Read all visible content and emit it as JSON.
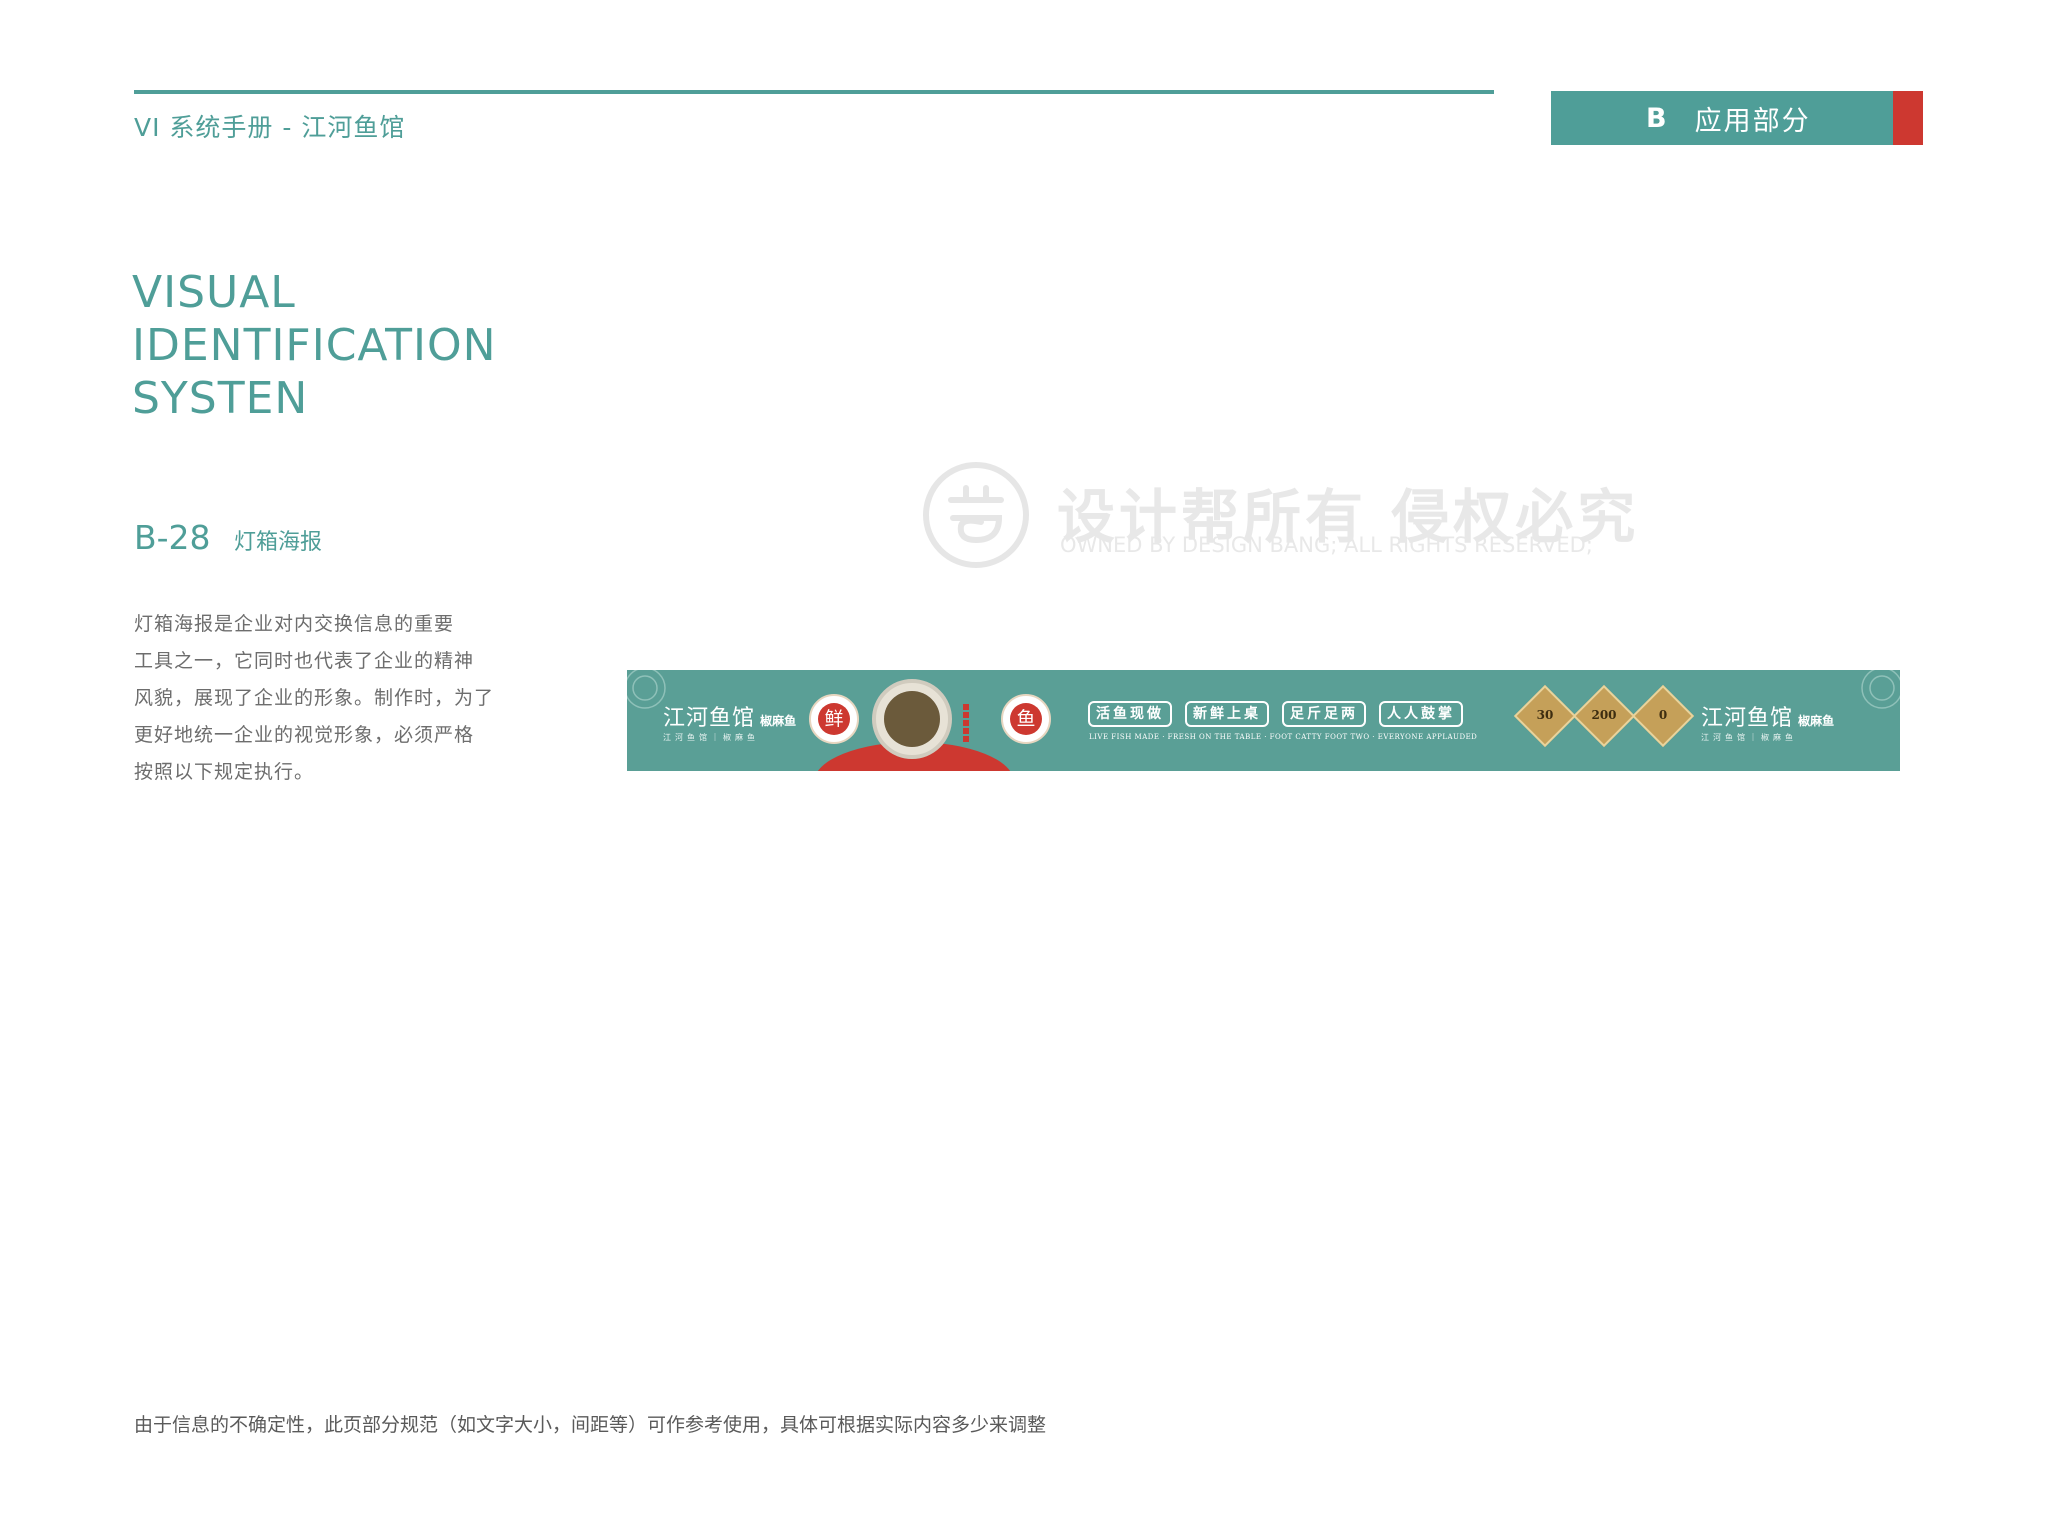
{
  "header": {
    "manual_title": "VI 系统手册 - 江河鱼馆",
    "section_letter": "B",
    "section_name": "应用部分"
  },
  "title_lines": [
    "VISUAL",
    "IDENTIFICATION",
    "SYSTEN"
  ],
  "item": {
    "code": "B-28",
    "name": "灯箱海报"
  },
  "description_lines": [
    "灯箱海报是企业对内交换信息的重要",
    "工具之一，它同时也代表了企业的精神",
    "风貌，展现了企业的形象。制作时，为了",
    "更好地统一企业的视觉形象，必须严格",
    "按照以下规定执行。"
  ],
  "watermark": {
    "cn": "设计帮所有 侵权必究",
    "en": "OWNED BY DESIGN BANG; ALL RIGHTS RESERVED;"
  },
  "banner": {
    "brand_main": "江河鱼馆",
    "brand_small": "椒麻鱼",
    "brand_sub": "江河鱼馆｜椒麻鱼",
    "seal_left": "鲜",
    "seal_right": "鱼",
    "slogans": [
      "活鱼现做",
      "新鲜上桌",
      "足斤足两",
      "人人鼓掌"
    ],
    "slogan_en": "LIVE FISH MADE · FRESH ON THE TABLE · FOOT CATTY FOOT TWO · EVERYONE APPLAUDED",
    "medals": [
      "30",
      "200",
      "0"
    ],
    "colors": {
      "background": "#5a9f96",
      "accent_red": "#cd3830",
      "gold": "#c5a059"
    }
  },
  "footnote": "由于信息的不确定性，此页部分规范（如文字大小，间距等）可作参考使用，具体可根据实际内容多少来调整",
  "colors": {
    "primary_teal": "#4f9e98",
    "accent_red": "#cd3830"
  }
}
